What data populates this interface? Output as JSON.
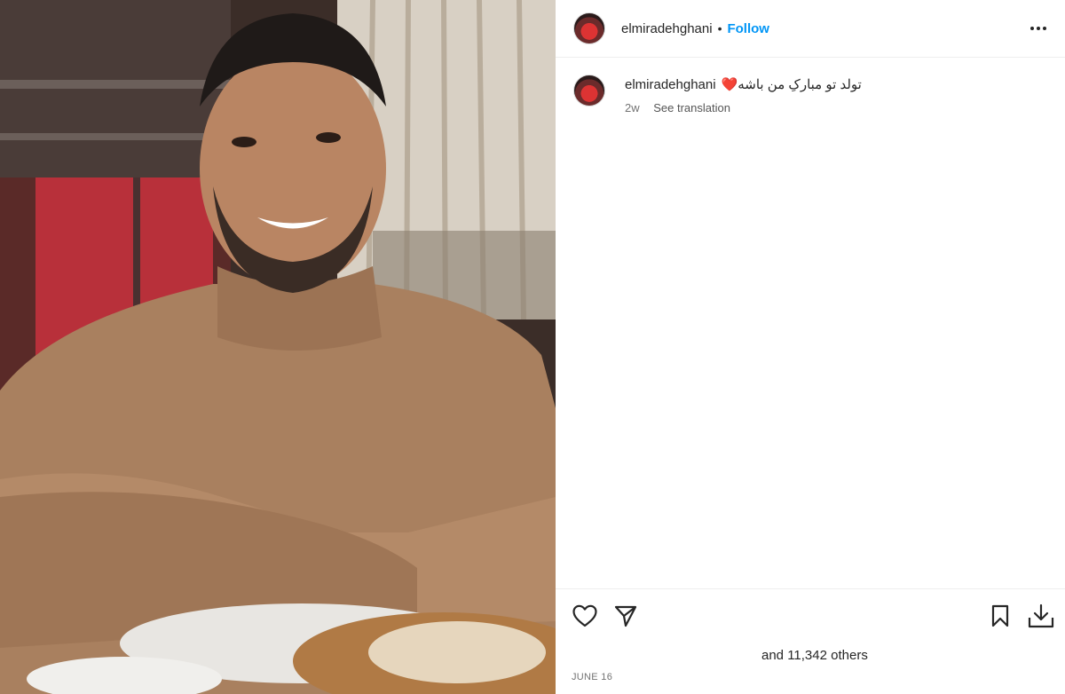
{
  "post": {
    "username": "elmiradehghani",
    "separator": "•",
    "follow_label": "Follow",
    "more_icon": "more-options-icon",
    "caption_username": "elmiradehghani",
    "caption_text": "تولد تو مبارکِ من باشه❤️",
    "time_ago": "2w",
    "see_translation": "See translation",
    "likes_text": "and 11,342 others",
    "date": "JUNE 16"
  },
  "icons": {
    "like": "heart-icon",
    "share": "paper-plane-icon",
    "save": "bookmark-icon",
    "download": "download-icon"
  },
  "colors": {
    "accent": "#0095f6",
    "text": "#262626",
    "muted": "#737373"
  }
}
